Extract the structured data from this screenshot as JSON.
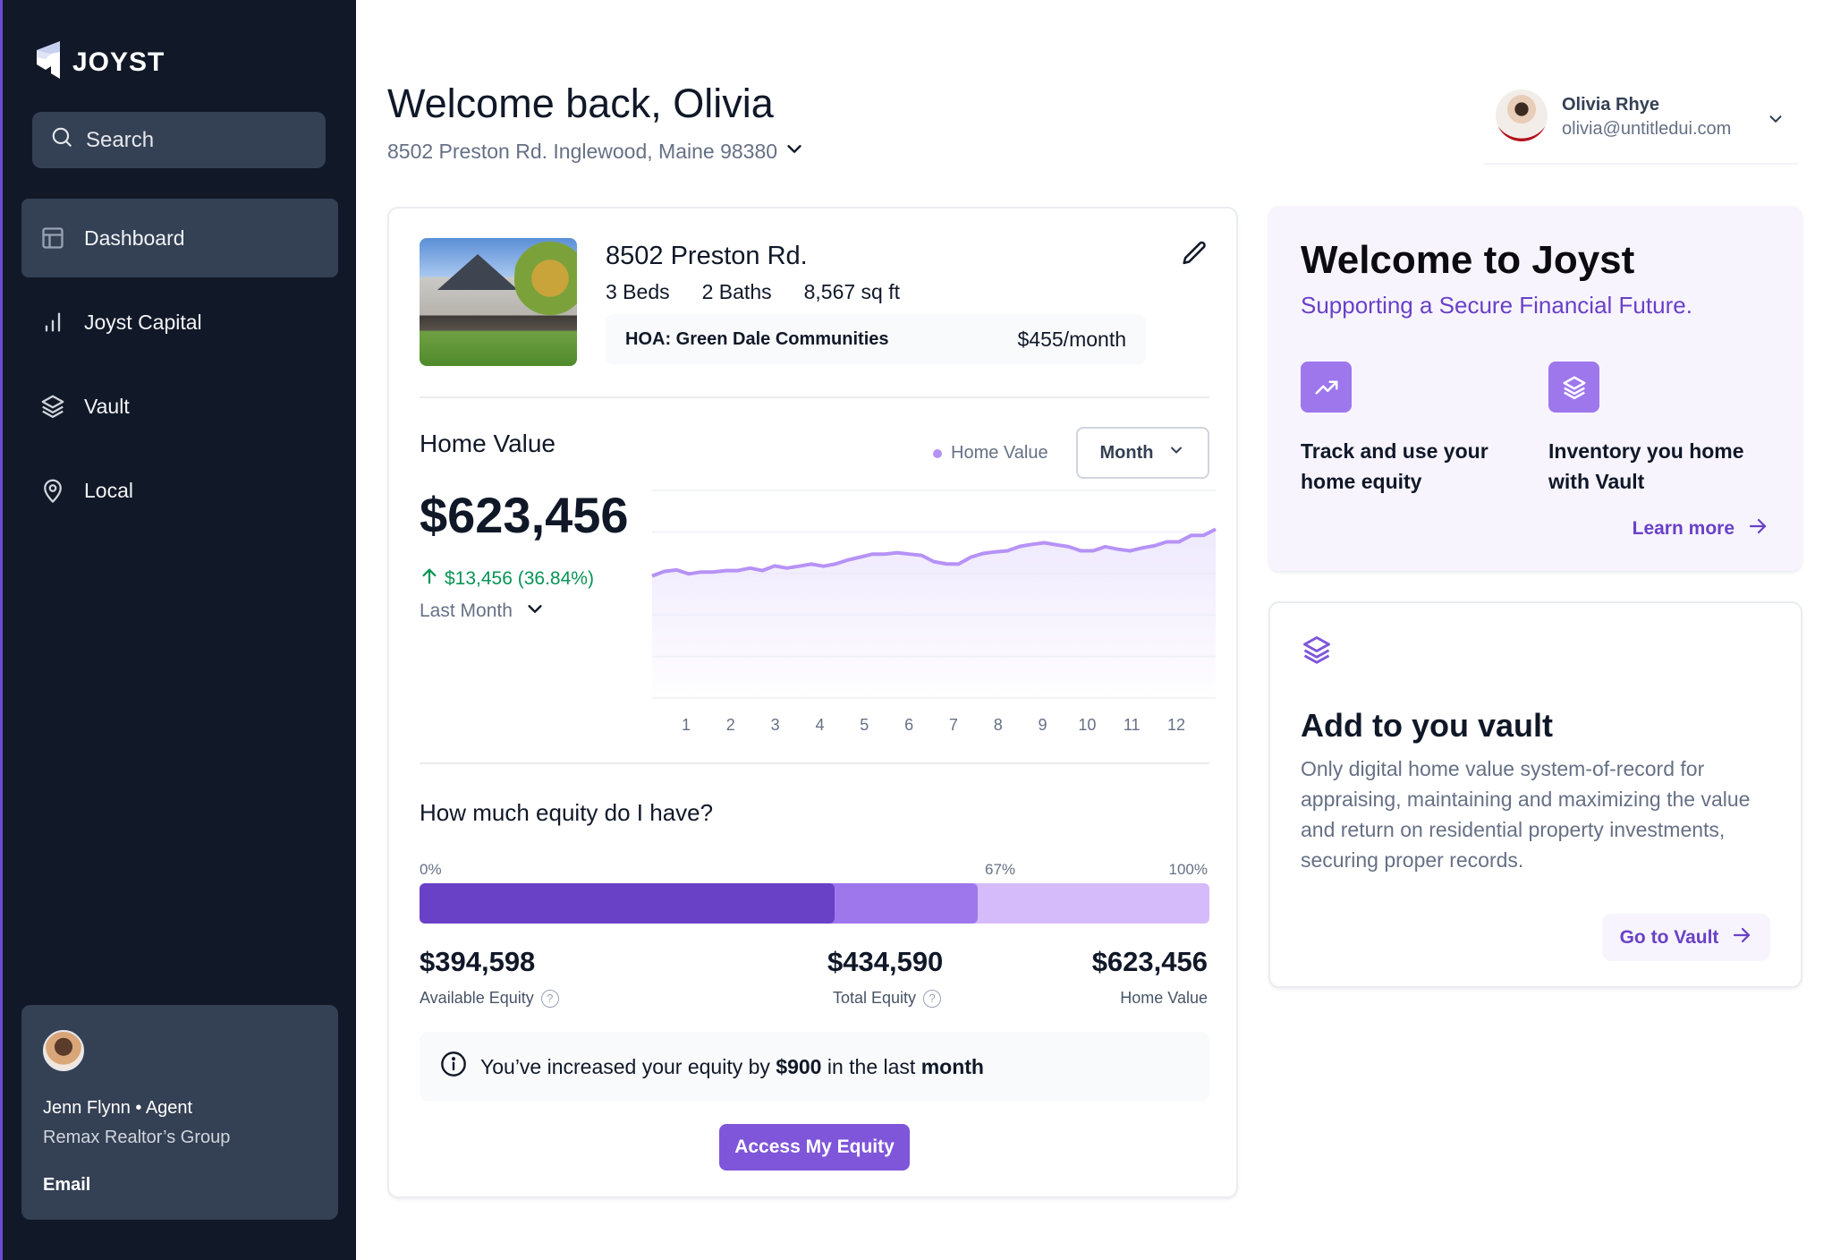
{
  "app": {
    "brand": "JOYST"
  },
  "sidebar": {
    "search_placeholder": "Search",
    "items": [
      {
        "label": "Dashboard",
        "icon": "layout-icon",
        "active": true
      },
      {
        "label": "Joyst Capital",
        "icon": "bar-chart-icon",
        "active": false
      },
      {
        "label": "Vault",
        "icon": "layers-icon",
        "active": false
      },
      {
        "label": "Local",
        "icon": "map-pin-icon",
        "active": false
      }
    ],
    "agent": {
      "name": "Jenn Flynn • Agent",
      "organization": "Remax Realtor’s Group",
      "email_label": "Email"
    }
  },
  "header": {
    "title": "Welcome back, Olivia",
    "address": "8502 Preston Rd. Inglewood, Maine 98380",
    "user": {
      "name": "Olivia Rhye",
      "email": "olivia@untitledui.com"
    }
  },
  "property": {
    "title": "8502 Preston Rd.",
    "beds": "3 Beds",
    "baths": "2 Baths",
    "area": "8,567 sq ft",
    "hoa_name": "HOA: Green Dale Communities",
    "hoa_price": "$455/month"
  },
  "home_value": {
    "title": "Home Value",
    "legend": "Home Value",
    "period_select": "Month",
    "value": "$623,456",
    "change": "$13,456 (36.84%)",
    "period": "Last Month"
  },
  "chart_data": {
    "type": "area",
    "title": "Home Value",
    "series": [
      {
        "name": "Home Value",
        "color": "#b692f6",
        "values": [
          58.8,
          61.0,
          61.7,
          59.8,
          60.7,
          60.7,
          61.4,
          61.4,
          62.6,
          61.4,
          63.6,
          62.6,
          63.5,
          64.5,
          63.5,
          64.6,
          66.5,
          67.9,
          69.3,
          69.3,
          70.0,
          69.3,
          68.7,
          65.7,
          64.6,
          64.5,
          67.8,
          69.6,
          70.4,
          70.9,
          73.0,
          74.0,
          74.8,
          73.8,
          72.9,
          70.9,
          70.9,
          72.9,
          71.7,
          70.9,
          72.3,
          73.3,
          75.2,
          75.2,
          78.3,
          78.3,
          81.3
        ]
      }
    ],
    "x_ticks": [
      "1",
      "2",
      "3",
      "4",
      "5",
      "6",
      "7",
      "8",
      "9",
      "10",
      "11",
      "12"
    ],
    "ylim": [
      0,
      100
    ],
    "y_gridlines": [
      0,
      20,
      40,
      60,
      80,
      100
    ],
    "grid": true,
    "xlabel": "",
    "ylabel": ""
  },
  "equity": {
    "title": "How much equity do I have?",
    "pct_labels": {
      "start": "0%",
      "mid": "67%",
      "end": "100%"
    },
    "available_fraction": 0.526,
    "total_fraction": 0.707,
    "colors": {
      "available": "#6941c6",
      "total": "#9e77ed",
      "home": "#d6bbfb"
    },
    "available_amount": "$394,598",
    "available_label": "Available Equity",
    "total_amount": "$434,590",
    "total_label": "Total Equity",
    "home_amount": "$623,456",
    "home_label": "Home Value",
    "callout_prefix": "You’ve increased your equity by ",
    "callout_amount": "$900",
    "callout_middle": " in the last ",
    "callout_period": "month",
    "cta_label": "Access My Equity"
  },
  "joyst_card": {
    "title": "Welcome to Joyst",
    "subtitle": "Supporting a Secure Financial Future.",
    "features": [
      {
        "icon": "trend-up-icon",
        "text": "Track and use your home equity"
      },
      {
        "icon": "layers-icon",
        "text": "Inventory you home with Vault"
      }
    ],
    "link_label": "Learn more"
  },
  "vault_card": {
    "title": "Add to you vault",
    "description": "Only digital home value system-of-record for appraising, maintaining and maximizing the value and return on residential property investments, securing proper records.",
    "button_label": "Go to Vault"
  }
}
